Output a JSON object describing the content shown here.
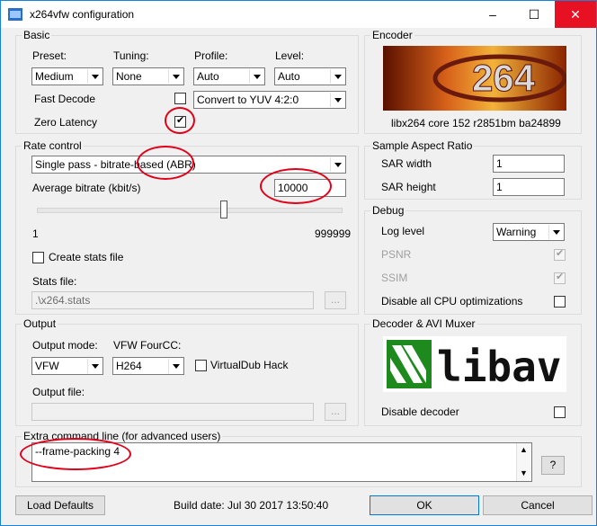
{
  "window": {
    "title": "x264vfw configuration",
    "minimize": "–",
    "maximize": "☐",
    "close": "✕"
  },
  "basic": {
    "legend": "Basic",
    "preset_label": "Preset:",
    "preset_value": "Medium",
    "tuning_label": "Tuning:",
    "tuning_value": "None",
    "profile_label": "Profile:",
    "profile_value": "Auto",
    "level_label": "Level:",
    "level_value": "Auto",
    "fast_decode_label": "Fast Decode",
    "fast_decode_checked": false,
    "colorspace_value": "Convert to YUV 4:2:0",
    "zero_latency_label": "Zero Latency",
    "zero_latency_checked": true
  },
  "encoder": {
    "legend": "Encoder",
    "logo_text": "264",
    "version": "libx264 core 152 r2851bm ba24899"
  },
  "rate_control": {
    "legend": "Rate control",
    "mode_value": "Single pass - bitrate-based (ABR)",
    "bitrate_label": "Average bitrate (kbit/s)",
    "bitrate_value": "10000",
    "slider_min": "1",
    "slider_max": "999999",
    "create_stats_label": "Create stats file",
    "stats_file_label": "Stats file:",
    "stats_file_value": ".\\x264.stats",
    "browse_label": "..."
  },
  "sar": {
    "legend": "Sample Aspect Ratio",
    "width_label": "SAR width",
    "width_value": "1",
    "height_label": "SAR height",
    "height_value": "1"
  },
  "debug": {
    "legend": "Debug",
    "log_level_label": "Log level",
    "log_level_value": "Warning",
    "psnr_label": "PSNR",
    "ssim_label": "SSIM",
    "disable_cpu_label": "Disable all CPU optimizations"
  },
  "output": {
    "legend": "Output",
    "mode_label": "Output mode:",
    "mode_value": "VFW",
    "fourcc_label": "VFW FourCC:",
    "fourcc_value": "H264",
    "vdub_label": "VirtualDub Hack",
    "file_label": "Output file:",
    "browse_label": "..."
  },
  "decoder": {
    "legend": "Decoder & AVI Muxer",
    "logo_text": "libav",
    "disable_decoder_label": "Disable decoder"
  },
  "extra": {
    "legend": "Extra command line (for advanced users)",
    "value": "--frame-packing 4",
    "help_label": "?"
  },
  "footer": {
    "load_defaults": "Load Defaults",
    "build_date": "Build date: Jul 30 2017 13:50:40",
    "ok": "OK",
    "cancel": "Cancel"
  },
  "colors": {
    "annotation": "#e1001a",
    "accent": "#0078d7",
    "logo_green": "#1e8a1e"
  },
  "icons": {
    "app": "app-icon"
  }
}
